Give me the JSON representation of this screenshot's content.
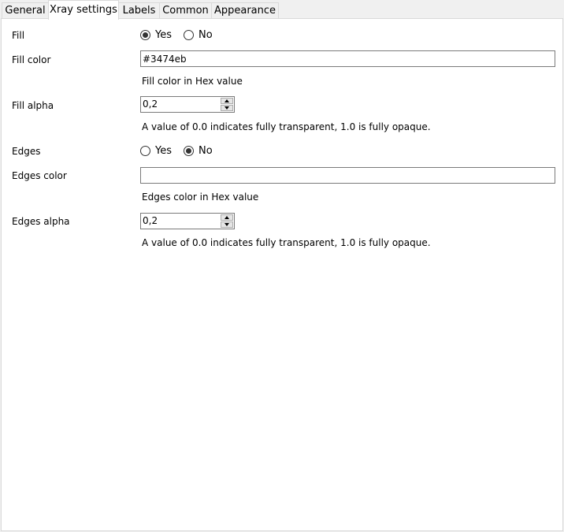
{
  "tabs": [
    {
      "label": "General",
      "active": false
    },
    {
      "label": "Xray settings",
      "active": true
    },
    {
      "label": "Labels",
      "active": false
    },
    {
      "label": "Common",
      "active": false
    },
    {
      "label": "Appearance",
      "active": false
    }
  ],
  "fill": {
    "label": "Fill",
    "options": [
      {
        "label": "Yes",
        "checked": true
      },
      {
        "label": "No",
        "checked": false
      }
    ]
  },
  "fill_color": {
    "label": "Fill color",
    "value": "#3474eb",
    "hint": "Fill color in Hex value"
  },
  "fill_alpha": {
    "label": "Fill alpha",
    "value": "0,2",
    "hint": "A value of 0.0 indicates fully transparent, 1.0 is fully opaque."
  },
  "edges": {
    "label": "Edges",
    "options": [
      {
        "label": "Yes",
        "checked": false
      },
      {
        "label": "No",
        "checked": true
      }
    ]
  },
  "edges_color": {
    "label": "Edges color",
    "value": "",
    "hint": "Edges color in Hex value"
  },
  "edges_alpha": {
    "label": "Edges alpha",
    "value": "0,2",
    "hint": "A value of 0.0 indicates fully transparent, 1.0 is fully opaque."
  }
}
